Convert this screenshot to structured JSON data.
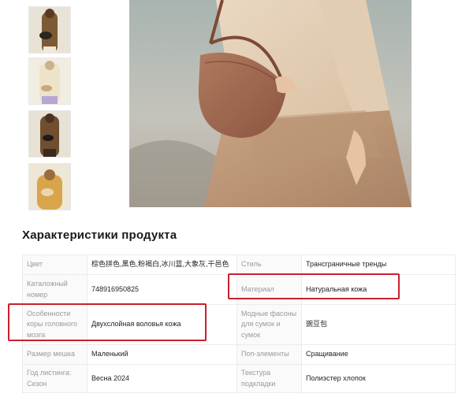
{
  "gallery": {
    "thumbnails": [
      "thumb-1",
      "thumb-2",
      "thumb-3",
      "thumb-4"
    ]
  },
  "product_characteristics": {
    "title": "Характеристики продукта",
    "rows": [
      {
        "k1": "Цвет",
        "v1": "棕色拼色,黑色,粉褐白,冰川蓝,大象灰,干邑色",
        "k2": "Стиль",
        "v2": "Трансграничные тренды"
      },
      {
        "k1": "Каталожный номер",
        "v1": "748916950825",
        "k2": "Материал",
        "v2": "Натуральная кожа"
      },
      {
        "k1": "Особенности коры головного мозга",
        "v1": "Двухслойная воловья кожа",
        "k2": "Модные фасоны для сумок и сумок",
        "v2": "豌豆包"
      },
      {
        "k1": "Размер мешка",
        "v1": "Маленький",
        "k2": "Поп-элементы",
        "v2": "Сращивание"
      },
      {
        "k1": "Год листинга: Сезон",
        "v1": "Весна 2024",
        "k2": "Текстура подкладки",
        "v2": "Полиэстер хлопок"
      }
    ]
  },
  "highlight_color": "#c8202f"
}
